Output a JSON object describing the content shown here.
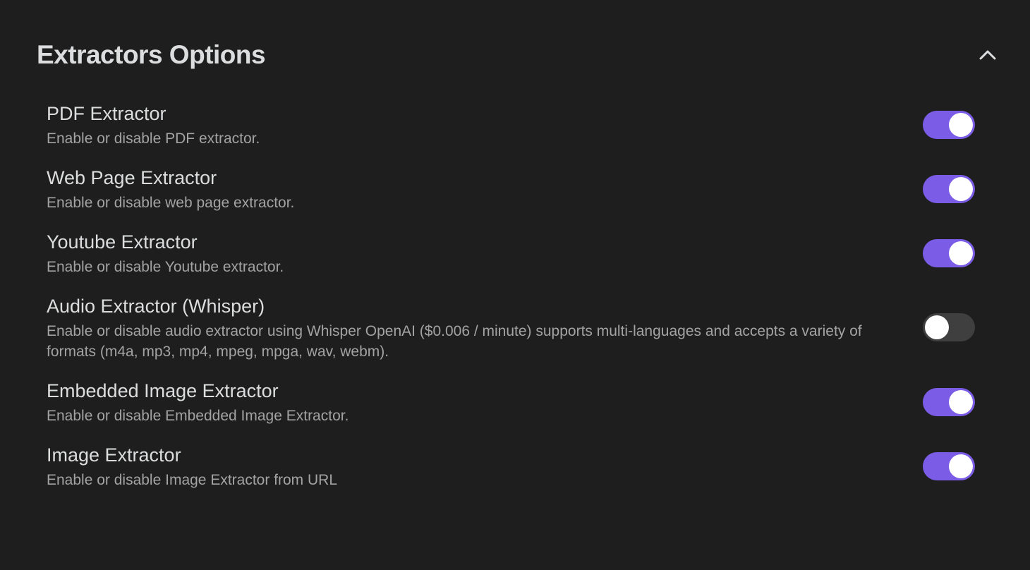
{
  "section": {
    "title": "Extractors Options",
    "collapse_icon": "chevron-up-icon"
  },
  "colors": {
    "background": "#1e1e1e",
    "toggle_on": "#7b5ce6",
    "toggle_off": "#3f3f3f"
  },
  "settings": [
    {
      "name": "PDF Extractor",
      "description": "Enable or disable PDF extractor.",
      "enabled": true
    },
    {
      "name": "Web Page Extractor",
      "description": "Enable or disable web page extractor.",
      "enabled": true
    },
    {
      "name": "Youtube Extractor",
      "description": "Enable or disable Youtube extractor.",
      "enabled": true
    },
    {
      "name": "Audio Extractor (Whisper)",
      "description": "Enable or disable audio extractor using Whisper OpenAI ($0.006 / minute) supports multi-languages and accepts a variety of formats (m4a, mp3, mp4, mpeg, mpga, wav, webm).",
      "enabled": false
    },
    {
      "name": "Embedded Image Extractor",
      "description": "Enable or disable Embedded Image Extractor.",
      "enabled": true
    },
    {
      "name": "Image Extractor",
      "description": "Enable or disable Image Extractor from URL",
      "enabled": true
    }
  ]
}
